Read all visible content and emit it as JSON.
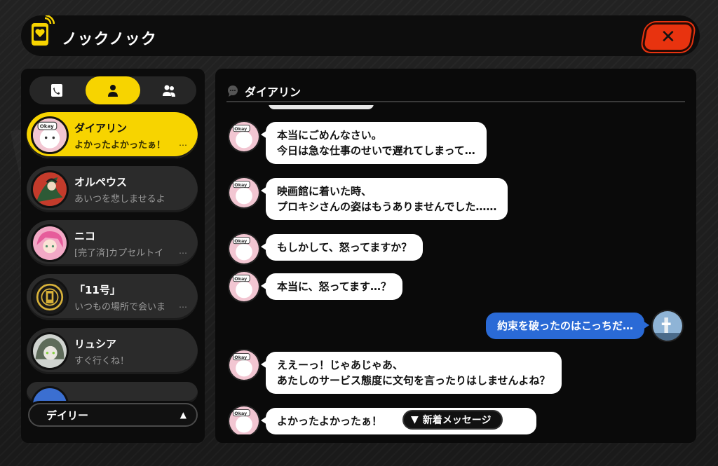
{
  "app": {
    "title": "ノックノック",
    "close_icon": "close-x-icon"
  },
  "tabs": [
    {
      "icon": "phone-contact-icon",
      "active": false
    },
    {
      "icon": "person-icon",
      "active": true
    },
    {
      "icon": "group-icon",
      "active": false
    }
  ],
  "contacts": [
    {
      "name": "ダイアリン",
      "preview": "よかったよかったぁ！",
      "more": "…",
      "active": true,
      "avatar": "okay-pink"
    },
    {
      "name": "オルペウス",
      "preview": "あいつを悲しませるよ",
      "more": "",
      "active": false,
      "avatar": "red-green"
    },
    {
      "name": "ニコ",
      "preview": "[完了済]カプセルトイ",
      "more": "…",
      "active": false,
      "avatar": "pink"
    },
    {
      "name": "「11号」",
      "preview": "いつもの場所で会いま",
      "more": "…",
      "active": false,
      "avatar": "yellow-emblem"
    },
    {
      "name": "リュシア",
      "preview": "すぐ行くね！",
      "more": "",
      "active": false,
      "avatar": "green-gray"
    }
  ],
  "daily": {
    "label": "デイリー",
    "arrow": "▲"
  },
  "chat": {
    "name": "ダイアリン",
    "messages": [
      {
        "from": "them",
        "lines": [
          "本当にごめんなさい。",
          "今日は急な仕事のせいで遅れてしまって…"
        ]
      },
      {
        "from": "them",
        "lines": [
          "映画館に着いた時、",
          "プロキシさんの姿はもうありませんでした……"
        ]
      },
      {
        "from": "them",
        "lines": [
          "もしかして、怒ってますか？"
        ]
      },
      {
        "from": "them",
        "lines": [
          "本当に、怒ってます…？"
        ]
      },
      {
        "from": "me",
        "lines": [
          "約束を破ったのはこっちだ…"
        ]
      },
      {
        "from": "them",
        "lines": [
          "ええーっ！じゃあじゃあ、",
          "あたしのサービス態度に文句を言ったりはしませんよね？"
        ]
      },
      {
        "from": "them",
        "lines": [
          "よかったよかったぁ！"
        ]
      }
    ],
    "new_message_label": "新着メッセージ",
    "new_message_arrow": "▼"
  },
  "colors": {
    "accent": "#f7d400",
    "close": "#e8330f",
    "my_bubble": "#2a6ad6"
  }
}
